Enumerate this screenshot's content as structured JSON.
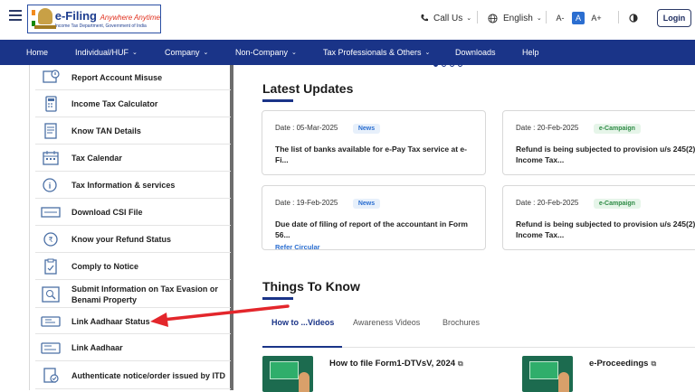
{
  "header": {
    "logo_title": "e-Filing",
    "logo_tagline": "Anywhere Anytime",
    "logo_subtitle": "Income Tax Department, Government of India",
    "call_us": "Call Us",
    "language": "English",
    "font_decrease": "A-",
    "font_normal": "A",
    "font_increase": "A+",
    "login": "Login"
  },
  "nav": {
    "items": [
      {
        "label": "Home",
        "has_menu": false
      },
      {
        "label": "Individual/HUF",
        "has_menu": true
      },
      {
        "label": "Company",
        "has_menu": true
      },
      {
        "label": "Non-Company",
        "has_menu": true
      },
      {
        "label": "Tax Professionals & Others",
        "has_menu": true
      },
      {
        "label": "Downloads",
        "has_menu": false
      },
      {
        "label": "Help",
        "has_menu": false
      }
    ]
  },
  "sidebar": {
    "items": [
      {
        "label": "Report Account Misuse",
        "icon": "report-icon"
      },
      {
        "label": "Income Tax Calculator",
        "icon": "calculator-icon"
      },
      {
        "label": "Know TAN Details",
        "icon": "tan-details-icon"
      },
      {
        "label": "Tax Calendar",
        "icon": "calendar-icon"
      },
      {
        "label": "Tax Information & services",
        "icon": "info-icon"
      },
      {
        "label": "Download CSI File",
        "icon": "download-icon"
      },
      {
        "label": "Know your Refund Status",
        "icon": "refund-icon"
      },
      {
        "label": "Comply to Notice",
        "icon": "notice-icon"
      },
      {
        "label": "Submit Information on Tax Evasion or Benami Property",
        "icon": "evasion-icon"
      },
      {
        "label": "Link Aadhaar Status",
        "icon": "aadhaar-status-icon"
      },
      {
        "label": "Link Aadhaar",
        "icon": "aadhaar-icon"
      },
      {
        "label": "Authenticate notice/order issued by ITD",
        "icon": "authenticate-icon"
      }
    ]
  },
  "latest_updates": {
    "title": "Latest Updates",
    "cards": [
      {
        "date": "Date : 05-Mar-2025",
        "badge": "News",
        "badge_type": "news",
        "text": "The list of banks available for e-Pay Tax service at e-Fi...",
        "link": ""
      },
      {
        "date": "Date : 20-Feb-2025",
        "badge": "e-Campaign",
        "badge_type": "camp",
        "text": "Refund is being subjected to provision u/s 245(2) of Income Tax...",
        "link": ""
      },
      {
        "date": "Date : 19-Feb-2025",
        "badge": "News",
        "badge_type": "news",
        "text": "Due date of filing of report of the accountant in Form 56...",
        "link": "Refer Circular"
      },
      {
        "date": "Date : 20-Feb-2025",
        "badge": "e-Campaign",
        "badge_type": "camp",
        "text": "Refund is being subjected to provision u/s 245(2) of Income Tax...",
        "link": ""
      }
    ]
  },
  "things_to_know": {
    "title": "Things To Know",
    "tabs": [
      "How to ...Videos",
      "Awareness Videos",
      "Brochures"
    ],
    "active_tab": 0,
    "videos": [
      {
        "title": "How to file Form1-DTVsV, 2024"
      },
      {
        "title": "e-Proceedings"
      }
    ]
  },
  "carousel": {
    "dots": 4,
    "active": 0
  },
  "colors": {
    "nav_bg": "#1a3488",
    "accent": "#2b6ed0",
    "arrow": "#e3262b"
  }
}
